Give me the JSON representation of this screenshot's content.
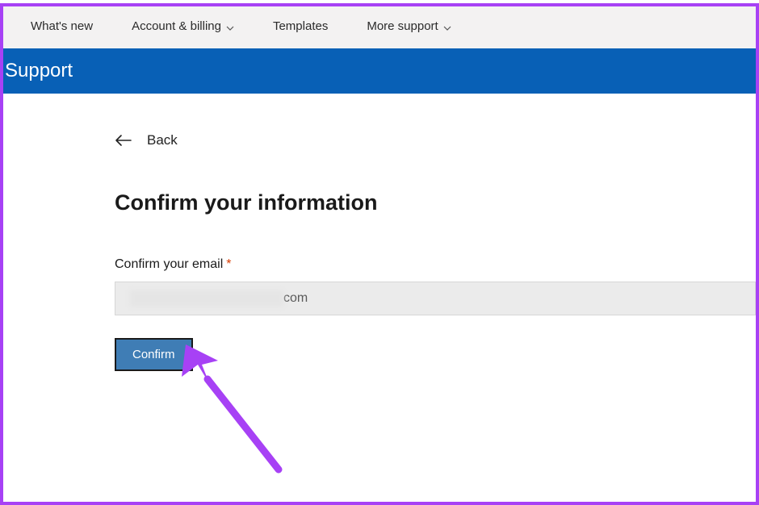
{
  "nav": {
    "whats_new": "What's new",
    "account_billing": "Account & billing",
    "templates": "Templates",
    "more_support": "More support"
  },
  "banner": {
    "title": "Support"
  },
  "back": {
    "label": "Back"
  },
  "heading": "Confirm your information",
  "form": {
    "email_label": "Confirm your email",
    "email_visible_suffix": "com",
    "confirm_label": "Confirm"
  }
}
